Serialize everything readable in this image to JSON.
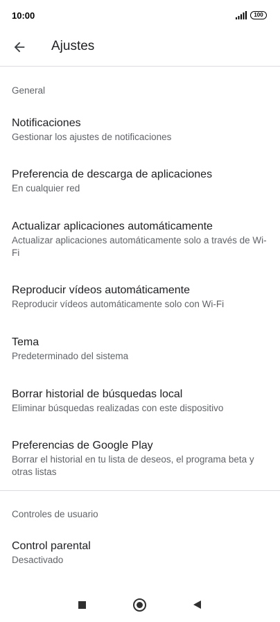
{
  "status_bar": {
    "time": "10:00",
    "battery": "100"
  },
  "header": {
    "title": "Ajustes"
  },
  "sections": {
    "general": {
      "title": "General",
      "items": [
        {
          "title": "Notificaciones",
          "subtitle": "Gestionar los ajustes de notificaciones"
        },
        {
          "title": "Preferencia de descarga de aplicaciones",
          "subtitle": "En cualquier red"
        },
        {
          "title": "Actualizar aplicaciones automáticamente",
          "subtitle": "Actualizar aplicaciones automáticamente solo a través de Wi-Fi"
        },
        {
          "title": "Reproducir vídeos automáticamente",
          "subtitle": "Reproducir vídeos automáticamente solo con Wi-Fi"
        },
        {
          "title": "Tema",
          "subtitle": "Predeterminado del sistema"
        },
        {
          "title": "Borrar historial de búsquedas local",
          "subtitle": "Eliminar búsquedas realizadas con este dispositivo"
        },
        {
          "title": "Preferencias de Google Play",
          "subtitle": "Borrar el historial en tu lista de deseos, el programa beta y otras listas"
        }
      ]
    },
    "user_controls": {
      "title": "Controles de usuario",
      "items": [
        {
          "title": "Control parental",
          "subtitle": "Desactivado"
        }
      ]
    }
  },
  "icons": {
    "back": "arrow-left-icon",
    "signal": "signal-icon",
    "battery": "battery-icon",
    "nav_recents": "square-icon",
    "nav_home": "circle-icon",
    "nav_back": "triangle-left-icon"
  },
  "colors": {
    "primary_text": "#202124",
    "secondary_text": "#5f6368",
    "divider": "#dadce0"
  }
}
